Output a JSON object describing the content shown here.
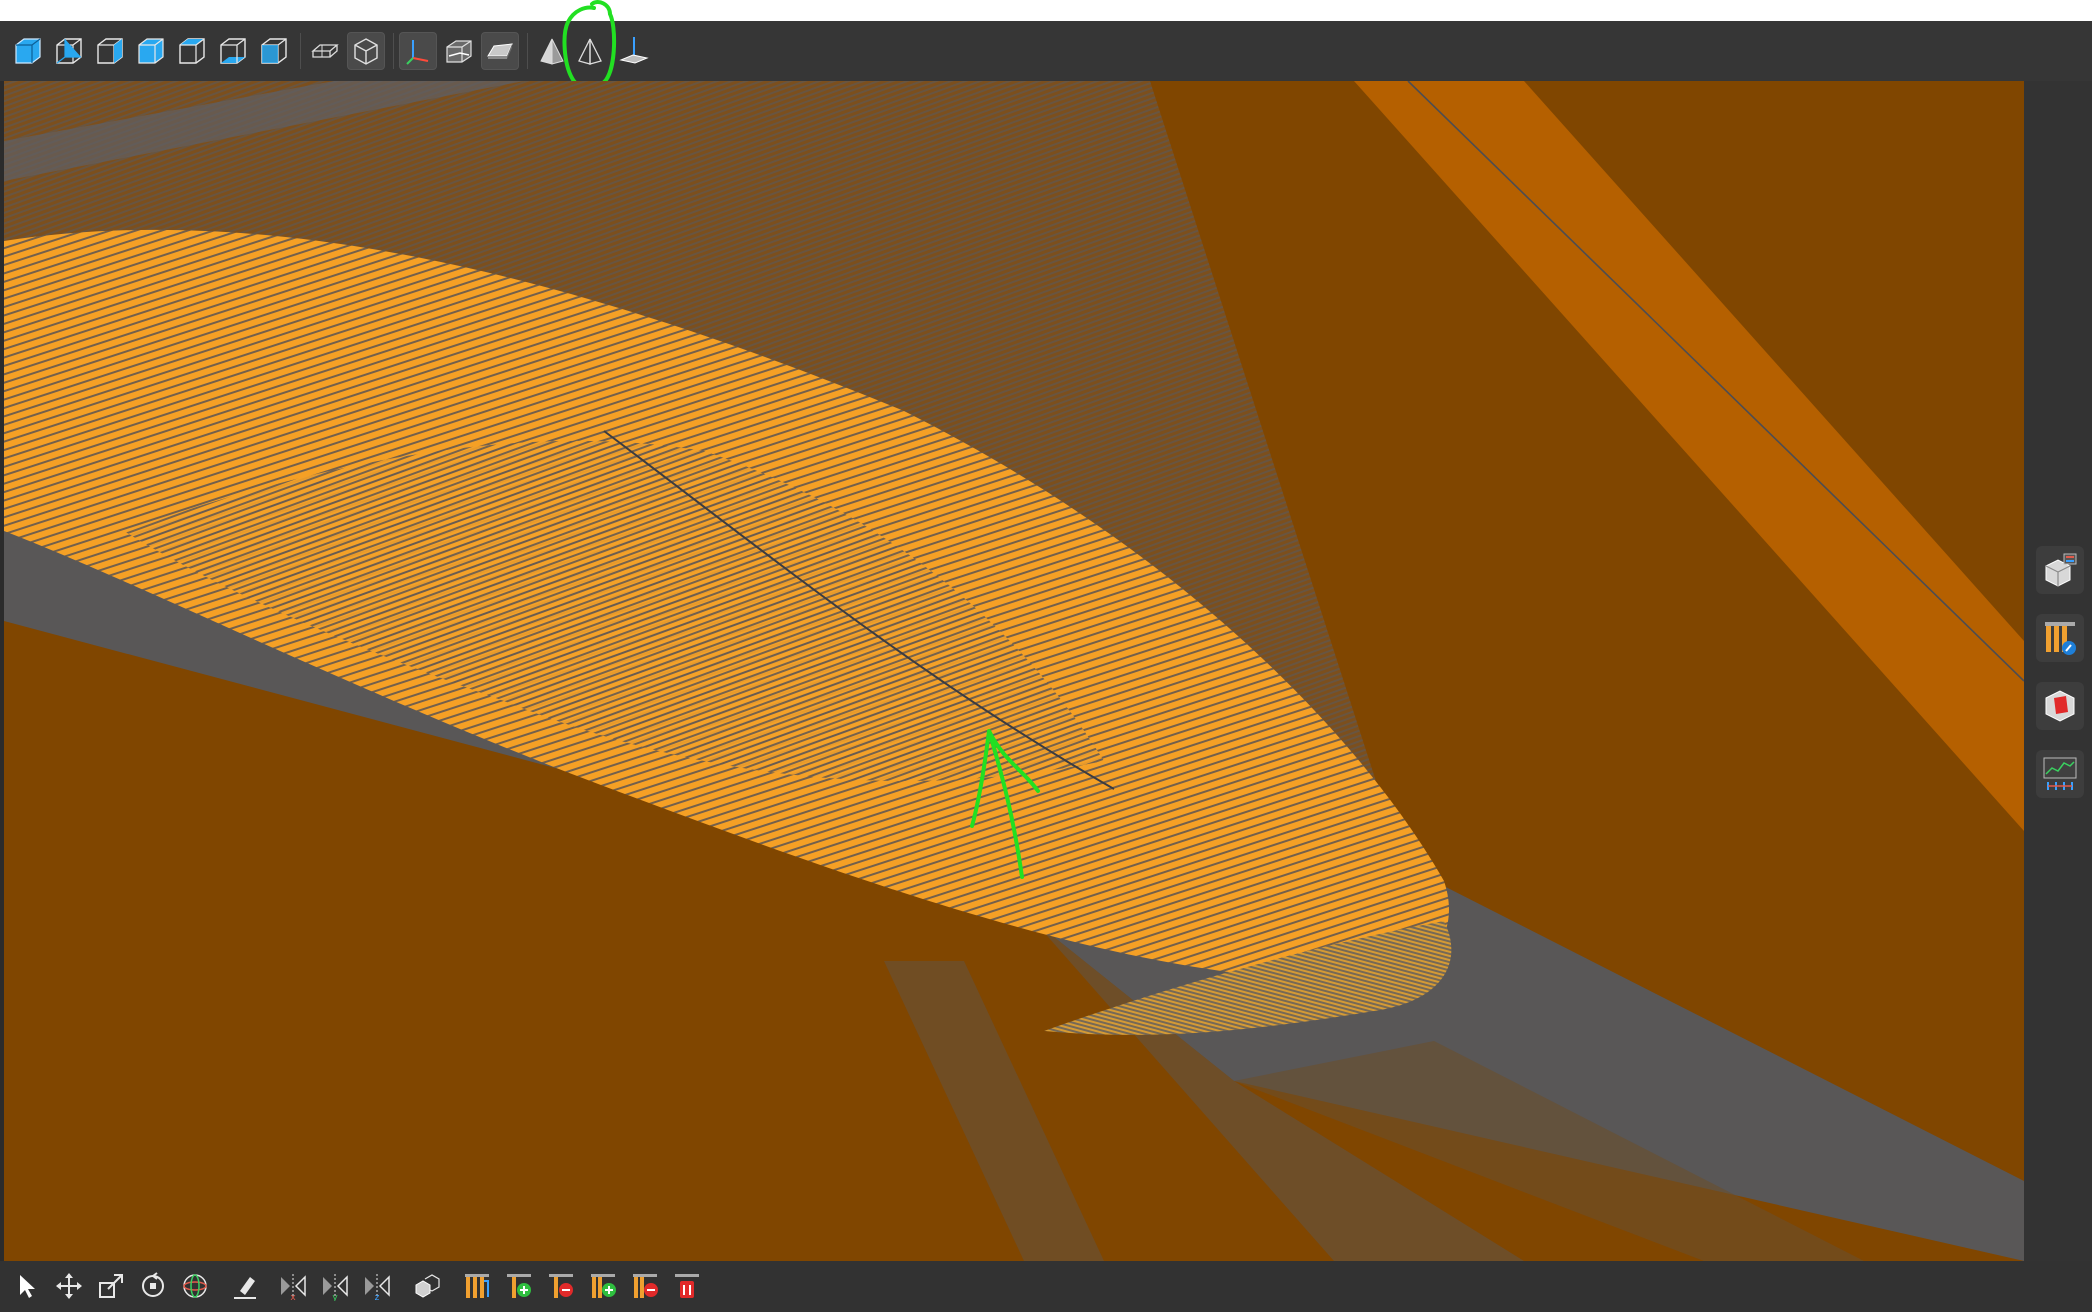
{
  "colors": {
    "background_orange": "#804600",
    "surface_orange": "#f5a025",
    "accent_orange": "#b56000",
    "hatch_gray": "#56585c",
    "annotation_green": "#22e022",
    "toolbar_bg": "#363636",
    "icon_blue": "#29a8f0"
  },
  "top_toolbar": {
    "items": [
      {
        "name": "view-front-icon"
      },
      {
        "name": "view-back-icon"
      },
      {
        "name": "view-left-icon"
      },
      {
        "name": "view-right-icon"
      },
      {
        "name": "view-top-icon"
      },
      {
        "name": "view-bottom-icon"
      },
      {
        "name": "view-iso-icon"
      },
      {
        "name": "orthographic-toggle-icon"
      },
      {
        "name": "perspective-toggle-icon"
      },
      {
        "name": "axes-toggle-icon"
      },
      {
        "name": "bounding-box-toggle-icon"
      },
      {
        "name": "shaded-display-icon"
      },
      {
        "name": "section-plane-icon"
      },
      {
        "name": "section-plane-flip-icon",
        "state": "active",
        "annotated": true
      },
      {
        "name": "ground-plane-icon"
      }
    ]
  },
  "right_panel": {
    "items": [
      {
        "name": "model-tree-icon"
      },
      {
        "name": "toolpath-editor-icon"
      },
      {
        "name": "stock-model-icon"
      },
      {
        "name": "analysis-graph-icon"
      }
    ]
  },
  "bottom_toolbar": {
    "items": [
      {
        "name": "select-arrow-icon"
      },
      {
        "name": "move-icon"
      },
      {
        "name": "scale-icon"
      },
      {
        "name": "rotate-icon"
      },
      {
        "name": "orbit-icon"
      },
      {
        "name": "measure-icon"
      },
      {
        "name": "mirror-x-icon"
      },
      {
        "name": "mirror-y-icon"
      },
      {
        "name": "mirror-z-icon"
      },
      {
        "name": "instance-icon"
      },
      {
        "name": "toolpath-icon"
      },
      {
        "name": "toolpath-add-icon"
      },
      {
        "name": "toolpath-remove-icon"
      },
      {
        "name": "toolpath-insert-icon"
      },
      {
        "name": "toolpath-delete-icon"
      },
      {
        "name": "toolpath-clear-icon"
      }
    ]
  },
  "annotation": {
    "description_marks": [
      "green-circle-around-tool",
      "green-arrow-pointing-to-seam"
    ]
  }
}
